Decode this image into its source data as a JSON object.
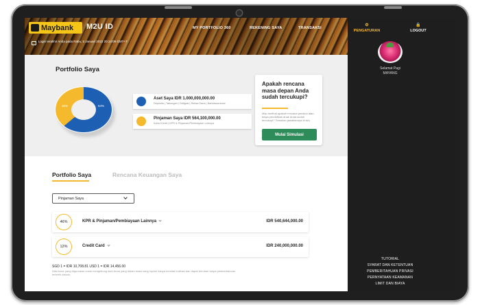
{
  "header": {
    "brand": "Maybank",
    "app_name": "M2U ID",
    "nav": {
      "portfolio": "MY PORTFOLIO 360",
      "accounts": "REKENING SAYA",
      "transactions": "TRANSAKSI"
    },
    "login_info": "Login terakhir Anda pada Rabu, 5 Januari 2022 20:14:09 GMT+7"
  },
  "portfolio": {
    "title": "Portfolio Saya",
    "chart": {
      "segment_asset_label": "64%",
      "segment_loan_label": "36%"
    },
    "assets": {
      "title": "Aset Saya  IDR 1.000,000,000.00",
      "subtitle": "Deposito | Tabungan | Obligasi | Reksa Dana | Bancassurance"
    },
    "loans": {
      "title": "Pinjaman Saya  IDR 564,100,000.00",
      "subtitle": "Kartu Kredit | KPR & Pinjaman/Pembiayaan Lainnya"
    }
  },
  "promo": {
    "title": "Apakah rencana masa depan Anda sudah tercukupi?",
    "body": "Mau melihat apakah rencana pensiun atau biaya pendidikan anak Anda sudah tercukupi? Temukan jawabannya di sini.",
    "button": "Mulai Simulasi"
  },
  "tabs": {
    "portfolio": "Portfolio Saya",
    "financial_plan": "Rencana Keuangan Saya"
  },
  "filter": {
    "selected": "Pinjaman Saya"
  },
  "loan_items": [
    {
      "percent": "46%",
      "name": "KPR & Pinjaman/Pembiayaan Lainnya",
      "amount": "IDR 540,644,000.00"
    },
    {
      "percent": "12%",
      "name": "Credit Card",
      "amount": "IDR 240,000,000.00"
    }
  ],
  "footer": {
    "rates": "SGD 1 = IDR 10,708.81    USD 1 = IDR 14,456.00",
    "disclaimer": "Nilai tukar yang digunakan untuk menghitung aset Anda yang dalam mata uang rupiah hanya bersifat indikasi dan dapat berubah tanpa pemberitahuan terlebih dahulu"
  },
  "sidebar": {
    "settings": "PENGATURAN",
    "logout": "LOGOUT",
    "greeting": "Selamat Pagi",
    "user_name": "MAYANG",
    "links": [
      "TUTORIAL",
      "SYARAT DAN KETENTUAN",
      "PEMBERITAHUAN PRIVASI",
      "PERNYATAAN KEAMANAN",
      "LIMIT DAN BIAYA"
    ]
  },
  "colors": {
    "accent": "#f5b92d",
    "asset_blue": "#1d5fb3",
    "button_green": "#2e8b5a",
    "sidebar_bg": "#1e1e1e"
  }
}
